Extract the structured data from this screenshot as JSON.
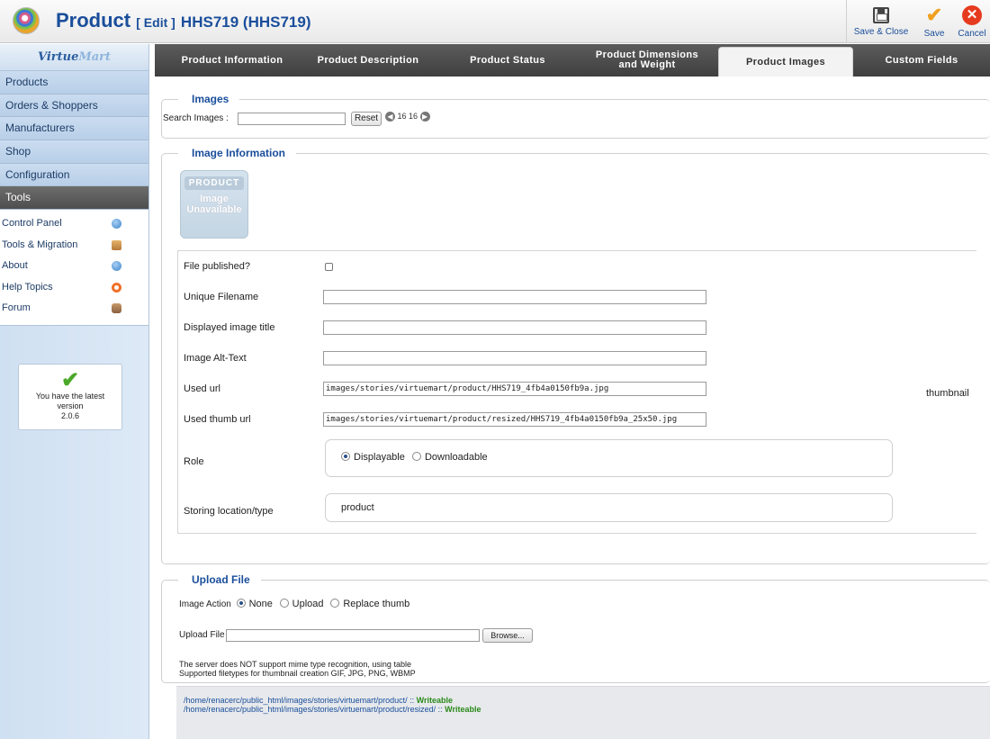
{
  "header": {
    "title": "Product",
    "edit_tag": "[ Edit ]",
    "product_id": "HHS719 (HHS719)"
  },
  "toolbar": {
    "save_close_label": "Save & Close",
    "save_label": "Save",
    "cancel_label": "Cancel"
  },
  "sidebar": {
    "logo_main": "Virtue",
    "logo_accent": "Mart",
    "menu": [
      {
        "label": "Products"
      },
      {
        "label": "Orders & Shoppers"
      },
      {
        "label": "Manufacturers"
      },
      {
        "label": "Shop"
      },
      {
        "label": "Configuration"
      },
      {
        "label": "Tools"
      }
    ],
    "sub_items": [
      {
        "label": "Control Panel",
        "icon": "info-icon"
      },
      {
        "label": "Tools & Migration",
        "icon": "box-icon"
      },
      {
        "label": "About",
        "icon": "info-icon"
      },
      {
        "label": "Help Topics",
        "icon": "lifebuoy-icon"
      },
      {
        "label": "Forum",
        "icon": "people-icon"
      }
    ],
    "version_box": {
      "line1": "You have the latest",
      "line2": "version",
      "line3": "2.0.6"
    }
  },
  "tabs": [
    {
      "label": "Product Information"
    },
    {
      "label": "Product Description"
    },
    {
      "label": "Product Status"
    },
    {
      "label": "Product Dimensions and Weight"
    },
    {
      "label": "Product Images"
    },
    {
      "label": "Custom Fields"
    }
  ],
  "images_section": {
    "legend": "Images",
    "search_label": "Search Images :",
    "search_value": "",
    "reset_label": "Reset",
    "page_size_a": "16",
    "page_size_b": "16"
  },
  "image_info": {
    "legend": "Image Information",
    "placeholder_band": "PRODUCT",
    "placeholder_line1": "Image",
    "placeholder_line2": "Unavailable",
    "thumbnail_label": "thumbnail",
    "fields": {
      "published_label": "File published?",
      "unique_filename_label": "Unique Filename",
      "unique_filename_value": "",
      "title_label": "Displayed image title",
      "title_value": "",
      "alt_label": "Image Alt-Text",
      "alt_value": "",
      "url_label": "Used url",
      "url_value": "images/stories/virtuemart/product/HHS719_4fb4a0150fb9a.jpg",
      "thumb_label": "Used thumb url",
      "thumb_value": "images/stories/virtuemart/product/resized/HHS719_4fb4a0150fb9a_25x50.jpg",
      "role_label": "Role",
      "role_option1": "Displayable",
      "role_option2": "Downloadable",
      "storing_label": "Storing location/type",
      "storing_value": "product"
    }
  },
  "upload": {
    "legend": "Upload File",
    "action_label": "Image Action",
    "action_none": "None",
    "action_upload": "Upload",
    "action_replace": "Replace thumb",
    "file_label": "Upload File",
    "browse_label": "Browse...",
    "note1": "The server does NOT support mime type recognition, using table",
    "note2": "Supported filetypes for thumbnail creation GIF, JPG, PNG, WBMP"
  },
  "paths": {
    "path1": "/home/renacerc/public_html/images/stories/virtuemart/product/",
    "path2": "/home/renacerc/public_html/images/stories/virtuemart/product/resized/",
    "separator": " :: ",
    "status": "Writeable"
  }
}
